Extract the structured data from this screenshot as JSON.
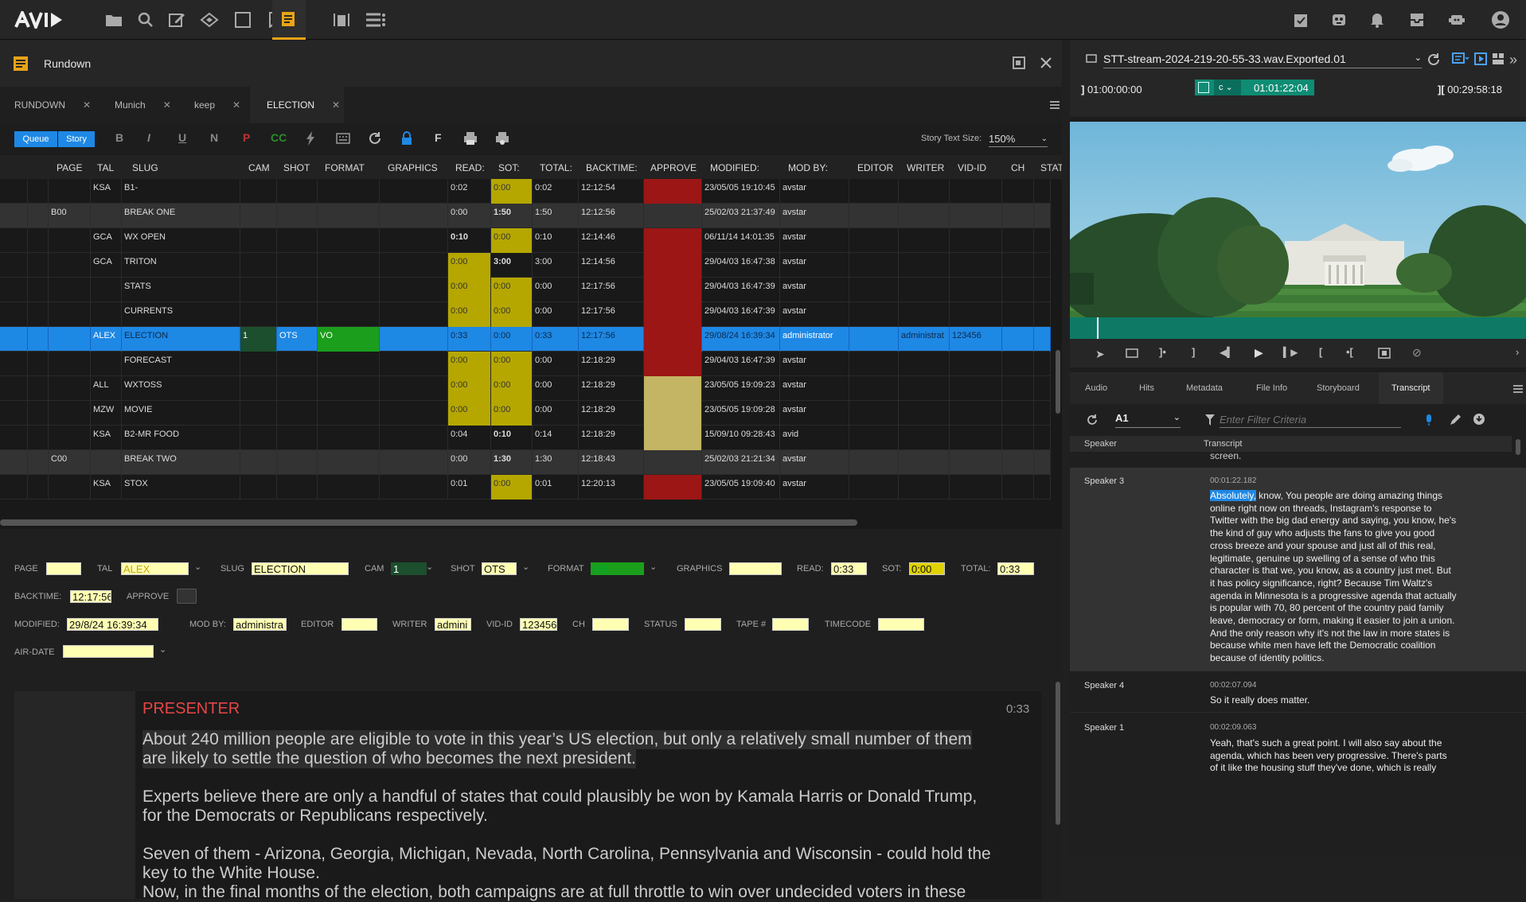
{
  "app": {
    "logo": "AVID"
  },
  "pane": {
    "title": "Rundown"
  },
  "tabs": [
    {
      "label": "RUNDOWN"
    },
    {
      "label": "Munich"
    },
    {
      "label": "keep"
    },
    {
      "label": "ELECTION"
    }
  ],
  "toolbar": {
    "queue": "Queue",
    "story": "Story",
    "b": "B",
    "i": "I",
    "u": "U",
    "n": "N",
    "p": "P",
    "cc": "CC",
    "f": "F",
    "story_text_size_label": "Story Text Size:",
    "story_text_size": "150%"
  },
  "grid": {
    "headers": [
      "PAGE",
      "TAL",
      "SLUG",
      "CAM",
      "SHOT",
      "FORMAT",
      "GRAPHICS",
      "READ:",
      "SOT:",
      "TOTAL:",
      "BACKTIME:",
      "APPROVE",
      "MODIFIED:",
      "MOD BY:",
      "EDITOR",
      "WRITER",
      "VID-ID",
      "CH",
      "STATU"
    ],
    "rows": [
      {
        "page": "",
        "tal": "KSA",
        "slug": "B1-",
        "read": "0:02",
        "sot": "0:00",
        "total": "0:02",
        "backtime": "12:12:54",
        "modified": "23/05/05 19:10:45",
        "modby": "avstar"
      },
      {
        "page": "B00",
        "tal": "",
        "slug": "BREAK ONE",
        "read": "0:00",
        "sot": "1:50",
        "total": "1:50",
        "backtime": "12:12:56",
        "modified": "25/02/03 21:37:49",
        "modby": "avstar"
      },
      {
        "page": "",
        "tal": "GCA",
        "slug": "WX OPEN",
        "read": "0:10",
        "sot": "0:00",
        "total": "0:10",
        "backtime": "12:14:46",
        "modified": "06/11/14 14:01:35",
        "modby": "avstar"
      },
      {
        "page": "",
        "tal": "GCA",
        "slug": "TRITON",
        "read": "0:00",
        "sot": "3:00",
        "total": "3:00",
        "backtime": "12:14:56",
        "modified": "29/04/03 16:47:38",
        "modby": "avstar"
      },
      {
        "page": "",
        "tal": "",
        "slug": "STATS",
        "read": "0:00",
        "sot": "0:00",
        "total": "0:00",
        "backtime": "12:17:56",
        "modified": "29/04/03 16:47:39",
        "modby": "avstar"
      },
      {
        "page": "",
        "tal": "",
        "slug": "CURRENTS",
        "read": "0:00",
        "sot": "0:00",
        "total": "0:00",
        "backtime": "12:17:56",
        "modified": "29/04/03 16:47:39",
        "modby": "avstar"
      },
      {
        "page": "",
        "tal": "ALEX",
        "slug": "ELECTION",
        "cam": "1",
        "shot": "OTS",
        "format": "VO",
        "read": "0:33",
        "sot": "0:00",
        "total": "0:33",
        "backtime": "12:17:56",
        "modified": "29/08/24 16:39:34",
        "modby": "administrator",
        "writer": "administrat",
        "vidid": "123456"
      },
      {
        "page": "",
        "tal": "",
        "slug": "FORECAST",
        "read": "0:00",
        "sot": "0:00",
        "total": "0:00",
        "backtime": "12:18:29",
        "modified": "29/04/03 16:47:39",
        "modby": "avstar"
      },
      {
        "page": "",
        "tal": "ALL",
        "slug": "WXTOSS",
        "read": "0:00",
        "sot": "0:00",
        "total": "0:00",
        "backtime": "12:18:29",
        "modified": "23/05/05 19:09:23",
        "modby": "avstar"
      },
      {
        "page": "",
        "tal": "MZW",
        "slug": "MOVIE",
        "read": "0:00",
        "sot": "0:00",
        "total": "0:00",
        "backtime": "12:18:29",
        "modified": "23/05/05 19:09:28",
        "modby": "avstar"
      },
      {
        "page": "",
        "tal": "KSA",
        "slug": "B2-MR FOOD",
        "read": "0:04",
        "sot": "0:10",
        "total": "0:14",
        "backtime": "12:18:29",
        "modified": "15/09/10 09:28:43",
        "modby": "avid"
      },
      {
        "page": "C00",
        "tal": "",
        "slug": "BREAK TWO",
        "read": "0:00",
        "sot": "1:30",
        "total": "1:30",
        "backtime": "12:18:43",
        "modified": "25/02/03 21:21:34",
        "modby": "avstar"
      },
      {
        "page": "",
        "tal": "KSA",
        "slug": "STOX",
        "read": "0:01",
        "sot": "0:00",
        "total": "0:01",
        "backtime": "12:20:13",
        "modified": "23/05/05 19:09:40",
        "modby": "avstar"
      }
    ]
  },
  "form": {
    "labels": {
      "page": "PAGE",
      "tal": "TAL",
      "slug": "SLUG",
      "cam": "CAM",
      "shot": "SHOT",
      "format": "FORMAT",
      "graphics": "GRAPHICS",
      "read": "READ:",
      "sot": "SOT:",
      "total": "TOTAL:",
      "backtime": "BACKTIME:",
      "approve": "APPROVE",
      "modified": "MODIFIED:",
      "modby": "MOD BY:",
      "editor": "EDITOR",
      "writer": "WRITER",
      "vidid": "VID-ID",
      "ch": "CH",
      "status": "STATUS",
      "tape": "TAPE #",
      "timecode": "TIMECODE",
      "airdate": "AIR-DATE"
    },
    "values": {
      "tal": "ALEX",
      "slug": "ELECTION",
      "cam": "1",
      "shot": "OTS",
      "format": "VO",
      "read": "0:33",
      "sot": "0:00",
      "total": "0:33",
      "backtime": "12:17:56",
      "modified": "29/8/24 16:39:34",
      "modby": "administra",
      "writer": "admini",
      "vidid": "123456"
    }
  },
  "story": {
    "presenter": "PRESENTER",
    "duration": "0:33",
    "lines": [
      "About 240 million people are eligible to vote in this year’s US election, but only a relatively small number of them",
      "are likely to settle the question of who becomes the next president.",
      "Experts believe there are only a handful of states that could plausibly be won by Kamala Harris or Donald Trump,",
      "for the Democrats or Republicans respectively.",
      "Seven of them - Arizona, Georgia, Michigan, Nevada, North Carolina, Pennsylvania and Wisconsin - could hold the",
      "key to the White House.",
      "Now, in the final months of the election, both campaigns are at full throttle to win over undecided voters in these"
    ]
  },
  "media": {
    "clip_name": "STT-stream-2024-219-20-55-33.wav.Exported.01",
    "tc_in": "01:00:00:00",
    "tc_mode": "c",
    "tc_current": "01:01:22:04",
    "tc_duration": "00:29:58:18"
  },
  "inspector_tabs": [
    "Audio",
    "Hits",
    "Metadata",
    "File Info",
    "Storyboard",
    "Transcript"
  ],
  "transcript": {
    "track": "A1",
    "filter_placeholder": "Enter Filter Criteria",
    "col_speaker": "Speaker",
    "col_transcript": "Transcript",
    "prev_tail": "screen.",
    "entries": [
      {
        "speaker": "Speaker 3",
        "time": "00:01:22.182",
        "highlight": "Absolutely,",
        "lines": [
          " know, You people are doing amazing things",
          "online right now on threads, Instagram's response to",
          "Twitter with the big dad energy and saying, you know, he's",
          "the kind of guy who adjusts the fans to give you good",
          "cross breeze and your spouse and just all of this real,",
          "legitimate, genuine up swelling of a sense of who this",
          "character is that we, you know, as a country just met. But",
          "it has policy significance, right? Because Tim Waltz's",
          "agenda in Minnesota is a progressive agenda that actually",
          "is popular with 70, 80 percent of the country paid family",
          "leave, democracy or form, making it easier to join a union.",
          "And the only reason why it's not the law in more states is",
          "because white men have left the Democratic coalition",
          "because of identity politics."
        ]
      },
      {
        "speaker": "Speaker 4",
        "time": "00:02:07.094",
        "lines": [
          "So it really does matter."
        ]
      },
      {
        "speaker": "Speaker 1",
        "time": "00:02:09.063",
        "lines": [
          "Yeah, that's such a great point. I will also say about the",
          "agenda, which has been very progressive. There's parts",
          "of it like the housing stuff they've done, which is really"
        ]
      }
    ]
  }
}
